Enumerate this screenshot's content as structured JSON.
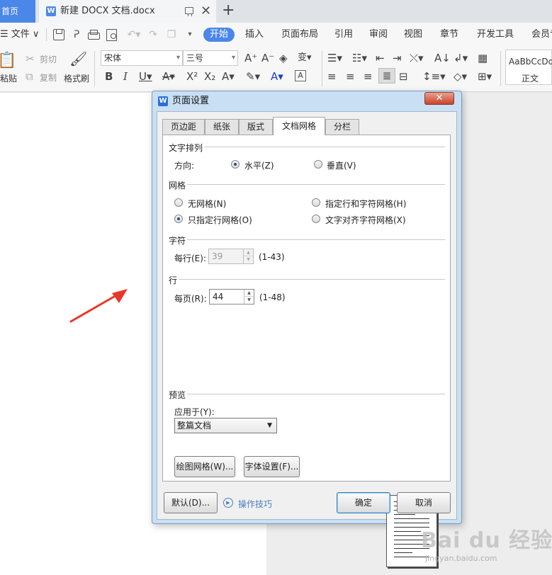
{
  "window": {
    "home_tab": "首页",
    "doc_tab_title": "新建 DOCX 文档.docx",
    "doc_tab_logo": "W",
    "close_glyph": "✕",
    "new_tab_glyph": "+"
  },
  "menubar": {
    "file_label": "☰ 文件 ∨",
    "active_tab": "开始",
    "items": [
      "插入",
      "页面布局",
      "引用",
      "审阅",
      "视图",
      "章节",
      "开发工具",
      "会员专享"
    ]
  },
  "ribbon": {
    "paste_label": "粘贴",
    "cut_label": "剪切",
    "copy_label": "复制",
    "format_painter_label": "格式刷",
    "font_name": "宋体",
    "font_size": "三号",
    "style_preview": "AaBbCcDd",
    "style_name": "正文"
  },
  "dialog": {
    "title": "页面设置",
    "close_glyph": "✕",
    "tabs": [
      "页边距",
      "纸张",
      "版式",
      "文档网格",
      "分栏"
    ],
    "active_tab_index": 3,
    "text_direction": {
      "section_title": "文字排列",
      "direction_label": "方向:",
      "horizontal_label": "水平(Z)",
      "vertical_label": "垂直(V)",
      "selected": "horizontal"
    },
    "grid": {
      "section_title": "网格",
      "no_grid_label": "无网格(N)",
      "line_and_char_grid_label": "指定行和字符网格(H)",
      "line_grid_only_label": "只指定行网格(O)",
      "text_snap_char_grid_label": "文字对齐字符网格(X)",
      "selected": "line_grid_only"
    },
    "chars": {
      "section_title": "字符",
      "per_line_label": "每行(E):",
      "per_line_value": "39",
      "per_line_range": "(1-43)"
    },
    "lines": {
      "section_title": "行",
      "per_page_label": "每页(R):",
      "per_page_value": "44",
      "per_page_range": "(1-48)"
    },
    "preview": {
      "section_title": "预览",
      "apply_to_label": "应用于(Y):",
      "apply_to_value": "整篇文档"
    },
    "buttons": {
      "drawing_grid": "绘图网格(W)...",
      "font_settings": "字体设置(F)...",
      "default": "默认(D)...",
      "tips": "操作技巧",
      "ok": "确定",
      "cancel": "取消"
    }
  },
  "watermark": {
    "brand": "Bai du 经验",
    "url": "jingyan.baidu.com"
  },
  "colors": {
    "accent": "#4a87e8",
    "arrow": "#e8372a",
    "dialog_frame": "#c9dff4"
  }
}
